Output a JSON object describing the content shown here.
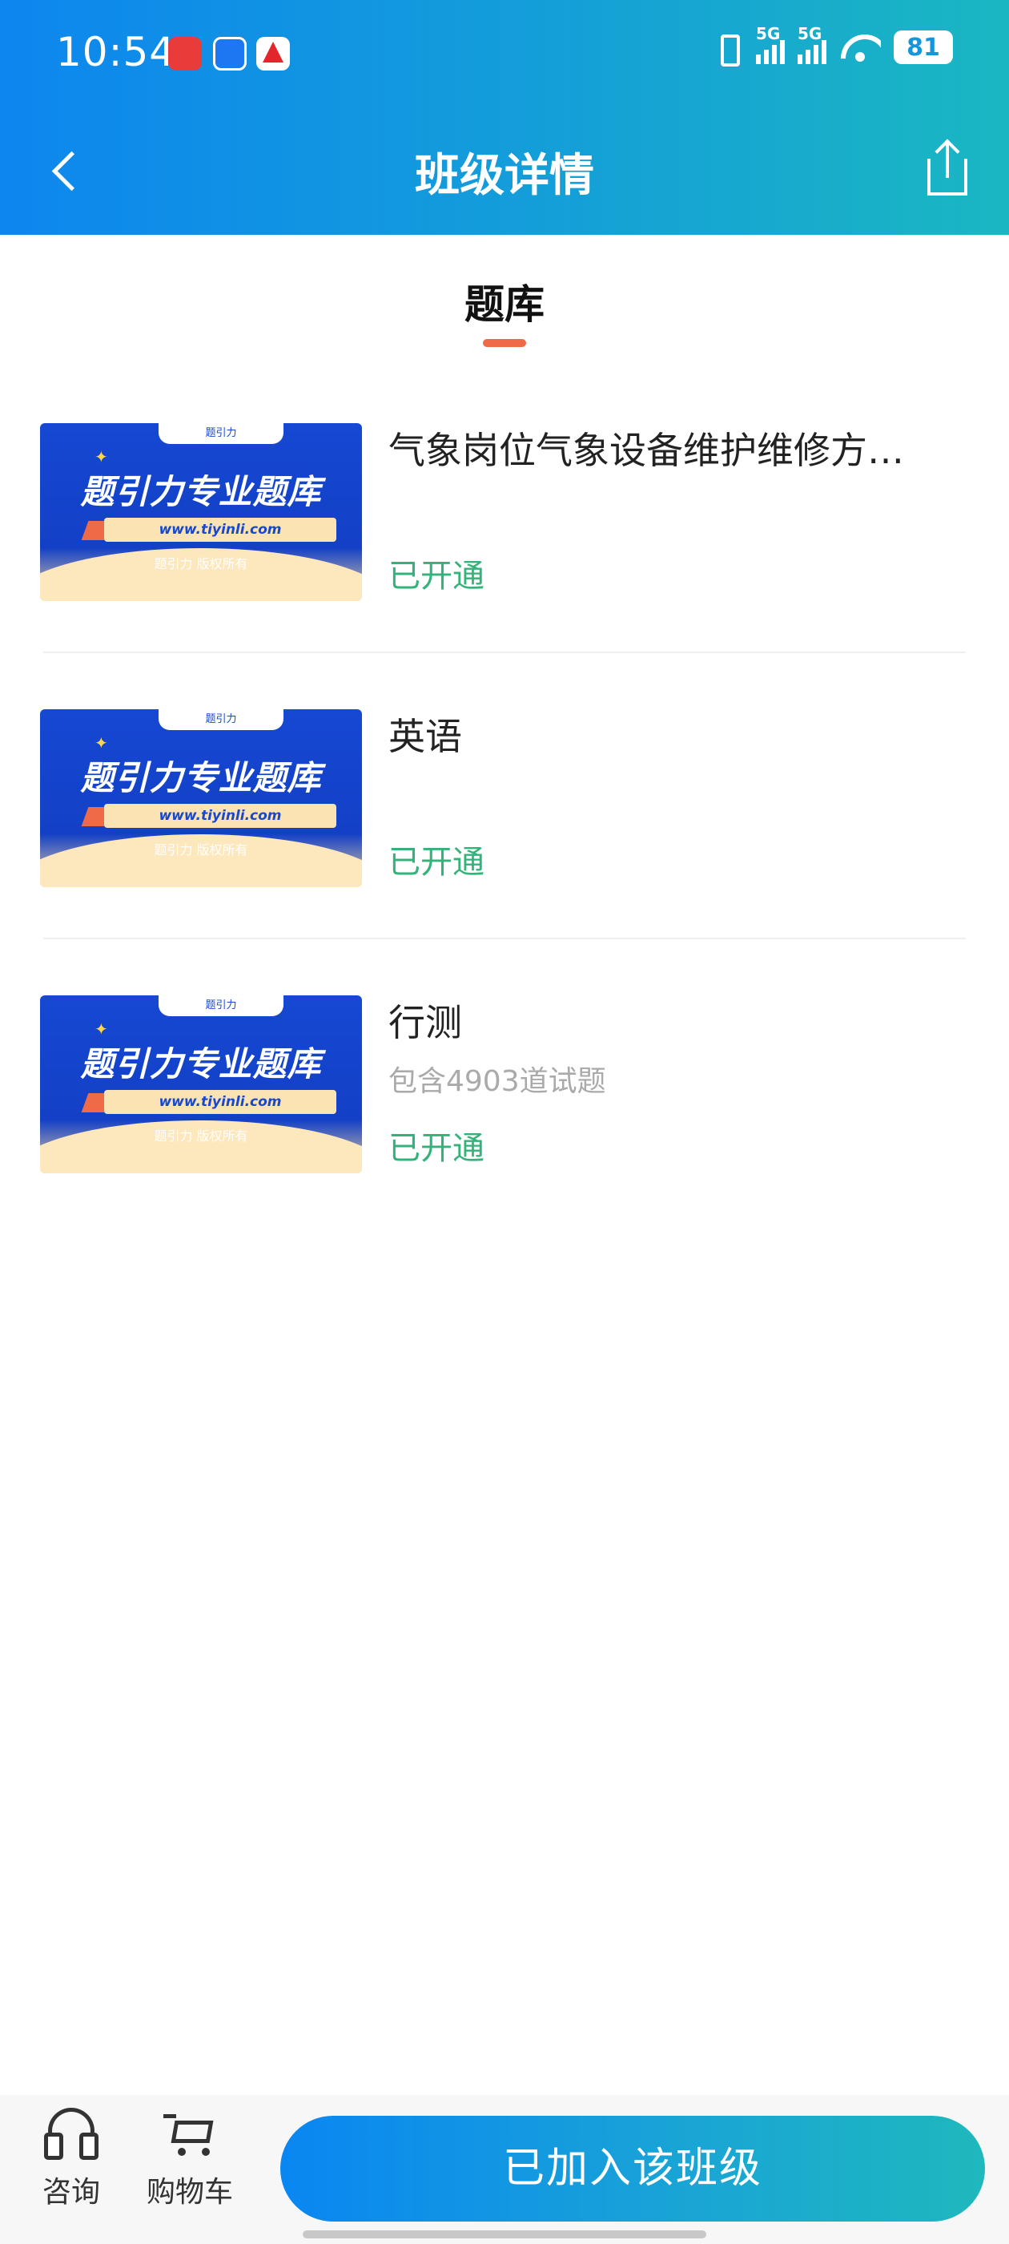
{
  "status_bar": {
    "time": "10:54",
    "network1": "5G",
    "network2": "5G",
    "battery": "81",
    "icons": [
      "vibrate-icon",
      "signal-icon",
      "signal-icon",
      "wifi-icon",
      "battery-icon"
    ]
  },
  "header": {
    "title": "班级详情",
    "back_icon": "chevron-left-icon",
    "share_icon": "share-icon"
  },
  "section": {
    "title": "题库"
  },
  "thumbnail": {
    "tab": "题引力",
    "main": "题引力专业题库",
    "url": "www.tiyinli.com",
    "copyright": "题引力 版权所有"
  },
  "items": [
    {
      "title": "气象岗位气象设备维护维修方…",
      "subtitle": "",
      "status": "已开通"
    },
    {
      "title": "英语",
      "subtitle": "",
      "status": "已开通"
    },
    {
      "title": "行测",
      "subtitle": "包含4903道试题",
      "status": "已开通"
    }
  ],
  "bottom_bar": {
    "consult_label": "咨询",
    "cart_label": "购物车",
    "join_button": "已加入该班级"
  },
  "colors": {
    "header_start": "#0d86ef",
    "header_end": "#1ab7c2",
    "accent": "#ef6a47",
    "status_green": "#33b37a"
  }
}
